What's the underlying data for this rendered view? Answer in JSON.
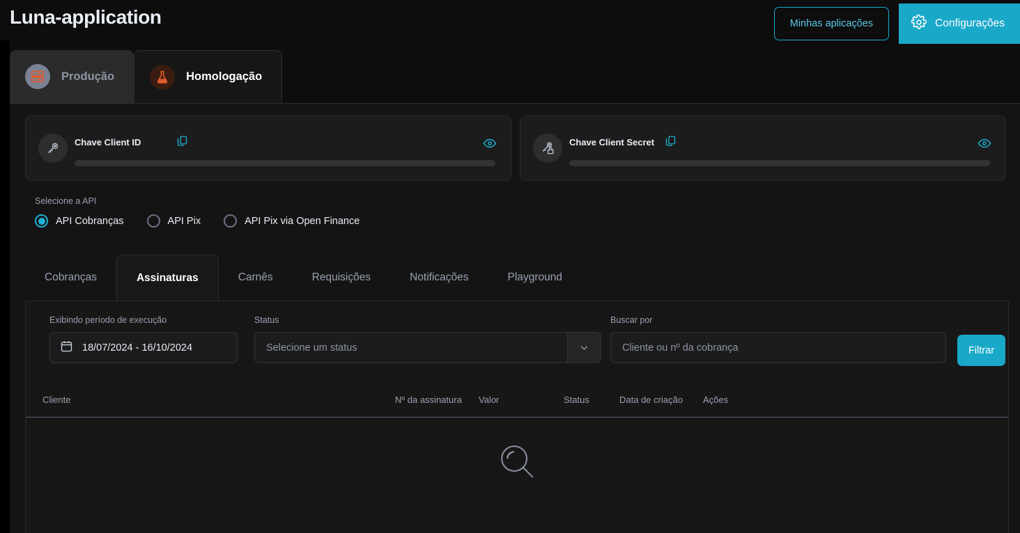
{
  "header": {
    "app_title": "Luna-application",
    "my_apps_label": "Minhas aplicações",
    "settings_label": "Configurações"
  },
  "env_tabs": [
    {
      "label": "Produção",
      "icon": "server-icon",
      "active": false
    },
    {
      "label": "Homologação",
      "icon": "flask-icon",
      "active": true
    }
  ],
  "credentials": [
    {
      "label": "Chave Client ID",
      "icon": "key-icon",
      "copy_icon": "copy-icon",
      "reveal_icon": "eye-icon"
    },
    {
      "label": "Chave Client Secret",
      "icon": "key-lock-icon",
      "copy_icon": "copy-icon",
      "reveal_icon": "eye-icon"
    }
  ],
  "api_select": {
    "caption": "Selecione a API",
    "options": [
      {
        "label": "API Cobranças",
        "selected": true
      },
      {
        "label": "API Pix",
        "selected": false
      },
      {
        "label": "API Pix via Open Finance",
        "selected": false
      }
    ]
  },
  "section_tabs": [
    {
      "label": "Cobranças",
      "active": false
    },
    {
      "label": "Assinaturas",
      "active": true
    },
    {
      "label": "Carnês",
      "active": false
    },
    {
      "label": "Requisições",
      "active": false
    },
    {
      "label": "Notificações",
      "active": false
    },
    {
      "label": "Playground",
      "active": false
    }
  ],
  "filters": {
    "date_label": "Exibindo período de execução",
    "date_value": "18/07/2024 - 16/10/2024",
    "date_icon": "calendar-icon",
    "status_label": "Status",
    "status_placeholder": "Selecione um status",
    "status_arrow_icon": "chevron-down-icon",
    "search_label": "Buscar por",
    "search_placeholder": "Cliente ou nº da cobrança",
    "filter_button": "Filtrar"
  },
  "table": {
    "columns": [
      "Cliente",
      "Nº da assinatura",
      "Valor",
      "Status",
      "Data de criação",
      "Ações"
    ],
    "rows": [],
    "empty_icon": "magnifier-icon"
  },
  "colors": {
    "accent": "#1aa8c9",
    "accent_light": "#5bc8e4",
    "orange": "#e05a2b",
    "page_bg": "#0d0d0d",
    "panel_bg": "#141414",
    "card_bg": "#1c1c1c"
  }
}
